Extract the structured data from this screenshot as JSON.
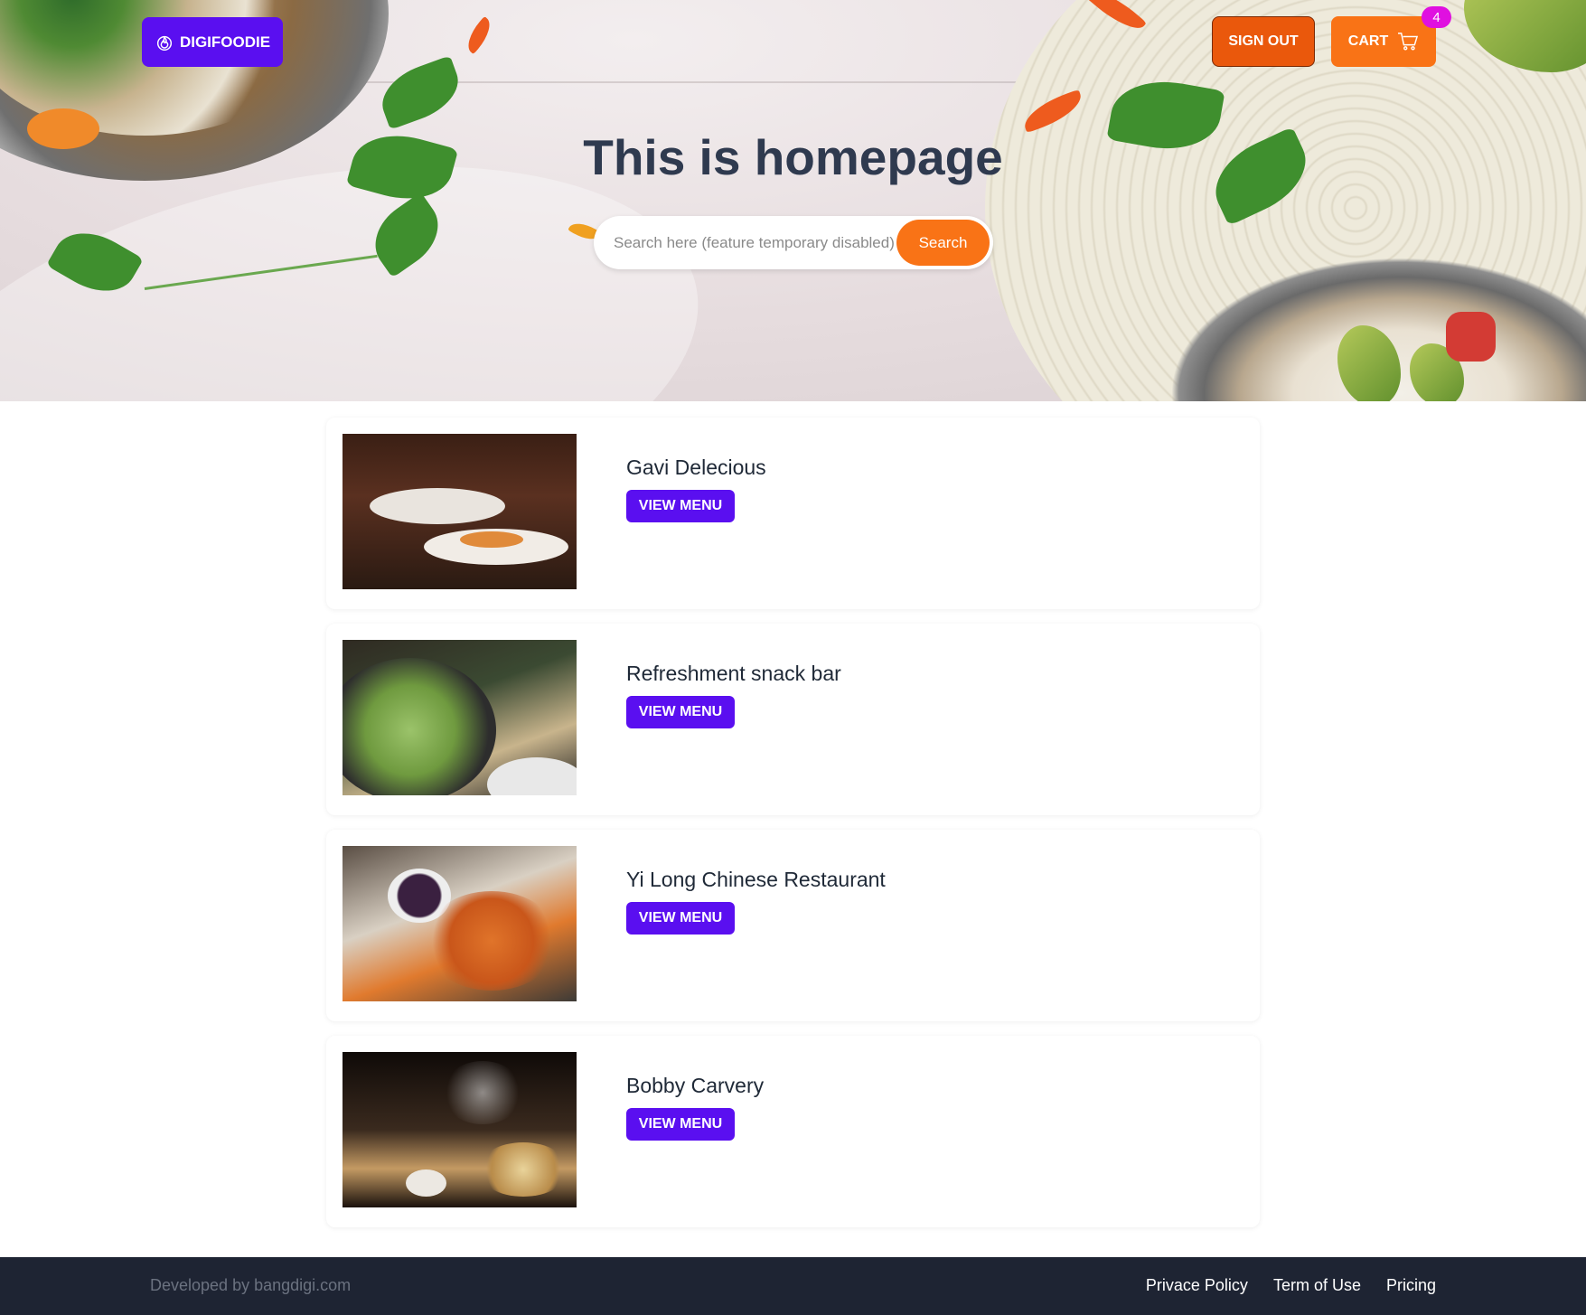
{
  "header": {
    "logo_label": "DIGIFOODIE",
    "signout_label": "SIGN OUT",
    "cart_label": "CART",
    "cart_count": "4"
  },
  "hero": {
    "title": "This is homepage",
    "search_placeholder": "Search here (feature temporary disabled)",
    "search_button": "Search"
  },
  "restaurants": [
    {
      "name": "Gavi Delecious",
      "button": "VIEW MENU"
    },
    {
      "name": "Refreshment snack bar",
      "button": "VIEW MENU"
    },
    {
      "name": "Yi Long Chinese Restaurant",
      "button": "VIEW MENU"
    },
    {
      "name": "Bobby Carvery",
      "button": "VIEW MENU"
    }
  ],
  "footer": {
    "developer": "Developed by bangdigi.com",
    "links": [
      "Privace Policy",
      "Term of Use",
      "Pricing"
    ]
  },
  "colors": {
    "brand": "#5a0ff0",
    "accent": "#f97316",
    "signout": "#ea580c",
    "badge": "#e010e0",
    "footer_bg": "#1e2433"
  }
}
